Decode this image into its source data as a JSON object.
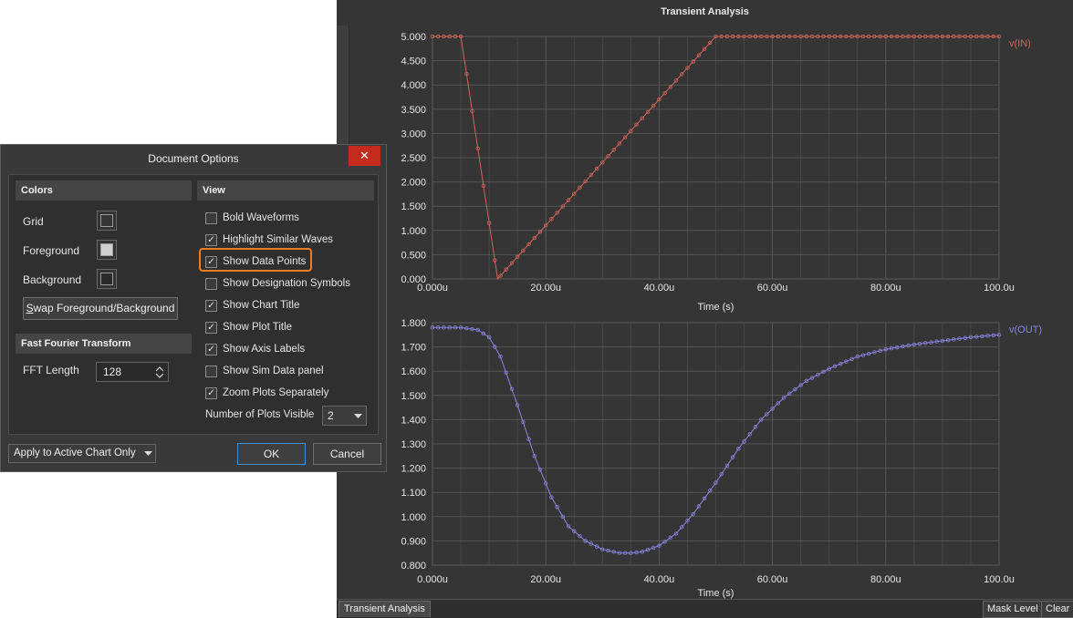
{
  "chart_window": {
    "title": "Transient Analysis",
    "bottom_tab": "Transient Analysis",
    "mask_level_label": "Mask Level",
    "clear_label": "Clear"
  },
  "chart_data": [
    {
      "type": "line",
      "series": [
        {
          "name": "v(IN)",
          "color": "#d06458",
          "x": [
            0,
            5,
            11.5,
            50,
            100
          ],
          "y": [
            5.0,
            5.0,
            0.0,
            5.0,
            5.0
          ]
        }
      ],
      "ylim": [
        0,
        5
      ],
      "yticks": [
        "0.000",
        "0.500",
        "1.000",
        "1.500",
        "2.000",
        "2.500",
        "3.000",
        "3.500",
        "4.000",
        "4.500",
        "5.000"
      ],
      "xlim": [
        0,
        100
      ],
      "xticks": [
        "0.000u",
        "20.00u",
        "40.00u",
        "60.00u",
        "80.00u",
        "100.0u"
      ],
      "xlabel": "Time (s)",
      "markers": true,
      "grid": true
    },
    {
      "type": "line",
      "series": [
        {
          "name": "v(OUT)",
          "color": "#8a84e0",
          "x": [
            0,
            5,
            8,
            10,
            12,
            15,
            18,
            21,
            24,
            27,
            30,
            33,
            35,
            37,
            40,
            43,
            46,
            50,
            54,
            58,
            62,
            66,
            70,
            75,
            80,
            85,
            90,
            95,
            100
          ],
          "y": [
            1.78,
            1.78,
            1.77,
            1.74,
            1.66,
            1.46,
            1.25,
            1.08,
            0.96,
            0.9,
            0.865,
            0.85,
            0.85,
            0.855,
            0.88,
            0.93,
            1.01,
            1.14,
            1.28,
            1.4,
            1.49,
            1.56,
            1.61,
            1.66,
            1.69,
            1.71,
            1.725,
            1.74,
            1.75
          ]
        }
      ],
      "ylim": [
        0.8,
        1.8
      ],
      "yticks": [
        "0.800",
        "0.900",
        "1.000",
        "1.100",
        "1.200",
        "1.300",
        "1.400",
        "1.500",
        "1.600",
        "1.700",
        "1.800"
      ],
      "xlim": [
        0,
        100
      ],
      "xticks": [
        "0.000u",
        "20.00u",
        "40.00u",
        "60.00u",
        "80.00u",
        "100.0u"
      ],
      "xlabel": "Time (s)",
      "markers": true,
      "grid": true
    }
  ],
  "dialog": {
    "title": "Document Options",
    "close_icon": "close-icon",
    "colors_header": "Colors",
    "grid_label": "Grid",
    "foreground_label": "Foreground",
    "background_label": "Background",
    "grid_color": "#353535",
    "foreground_color": "#d0d0d0",
    "background_color": "#2a2a2a",
    "swap_prefix": "S",
    "swap_rest": "wap Foreground/Background",
    "fft_header": "Fast Fourier Transform",
    "fft_length_label": "FFT Length",
    "fft_length_value": "128",
    "view_header": "View",
    "options": [
      {
        "label": "Bold Waveforms",
        "checked": false
      },
      {
        "label": "Highlight Similar Waves",
        "checked": true
      },
      {
        "label": "Show Data Points",
        "checked": true
      },
      {
        "label": "Show Designation Symbols",
        "checked": false
      },
      {
        "label": "Show Chart Title",
        "checked": true
      },
      {
        "label": "Show Plot Title",
        "checked": true
      },
      {
        "label": "Show Axis Labels",
        "checked": true
      },
      {
        "label": "Show Sim Data panel",
        "checked": false
      },
      {
        "label": "Zoom Plots Separately",
        "checked": true
      }
    ],
    "plots_visible_label": "Number of Plots Visible",
    "plots_visible_value": "2",
    "apply_label": "Apply to Active Chart Only",
    "ok_label": "OK",
    "cancel_label": "Cancel",
    "highlight_color": "#f07c1e"
  }
}
